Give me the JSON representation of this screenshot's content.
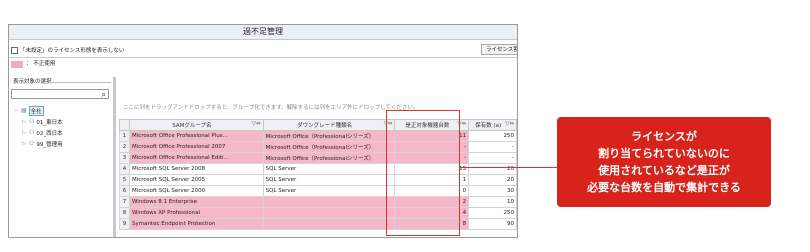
{
  "window": {
    "title": "過不足管理"
  },
  "options": {
    "hide_unset_label": "「未設定」のライセンス形態を表示しない",
    "license_button": "ライセンス割"
  },
  "legend": {
    "label": "： 不正使用",
    "color": "#f4a9bd"
  },
  "pane": {
    "title": "表示対象の選択",
    "tree": [
      {
        "label": "全社",
        "twist": "−"
      },
      {
        "label": "01_東日本",
        "twist": "▷"
      },
      {
        "label": "02_西日本",
        "twist": "▷"
      },
      {
        "label": "99_管理用",
        "twist": "▷"
      }
    ]
  },
  "grid": {
    "group_hint": "ここに列をドラッグアンドドロップすると、グループ化できます。解除するには列をエリア外にドロップしてください。",
    "columns": [
      "",
      "SAMグループ名",
      "ダウングレード種類名",
      "是正対象機器台数",
      "保有数 (a)"
    ],
    "rows": [
      {
        "n": "1",
        "name": "Microsoft Office Professional Plus…",
        "downgrade": "Microsoft Office（Professionalシリーズ）",
        "count": "11",
        "owned": "250",
        "pink": true
      },
      {
        "n": "2",
        "name": "Microsoft Office Professional 2007",
        "downgrade": "Microsoft Office（Professionalシリーズ）",
        "count": "-",
        "owned": "-",
        "pink": true
      },
      {
        "n": "3",
        "name": "Microsoft Office Professional Editi…",
        "downgrade": "Microsoft Office（Professionalシリーズ）",
        "count": "-",
        "owned": "-",
        "pink": true
      },
      {
        "n": "4",
        "name": "Microsoft SQL Server 2008",
        "downgrade": "SQL Server",
        "count": "15",
        "owned": "20",
        "pink": false
      },
      {
        "n": "5",
        "name": "Microsoft SQL Server 2005",
        "downgrade": "SQL Server",
        "count": "1",
        "owned": "20",
        "pink": false
      },
      {
        "n": "6",
        "name": "Microsoft SQL Server 2000",
        "downgrade": "SQL Server",
        "count": "0",
        "owned": "30",
        "pink": false
      },
      {
        "n": "7",
        "name": "Windows 8.1 Enterprise",
        "downgrade": "",
        "count": "2",
        "owned": "10",
        "pink": true
      },
      {
        "n": "8",
        "name": "Windows XP Professional",
        "downgrade": "",
        "count": "4",
        "owned": "250",
        "pink": true
      },
      {
        "n": "9",
        "name": "Symantec Endpoint Protection",
        "downgrade": "",
        "count": "8",
        "owned": "90",
        "pink": true
      }
    ]
  },
  "callout": {
    "lines": [
      "ライセンスが",
      "割り当てられていないのに",
      "使用されているなど是正が",
      "必要な台数を自動で集計できる"
    ],
    "color": "#d7231c"
  }
}
